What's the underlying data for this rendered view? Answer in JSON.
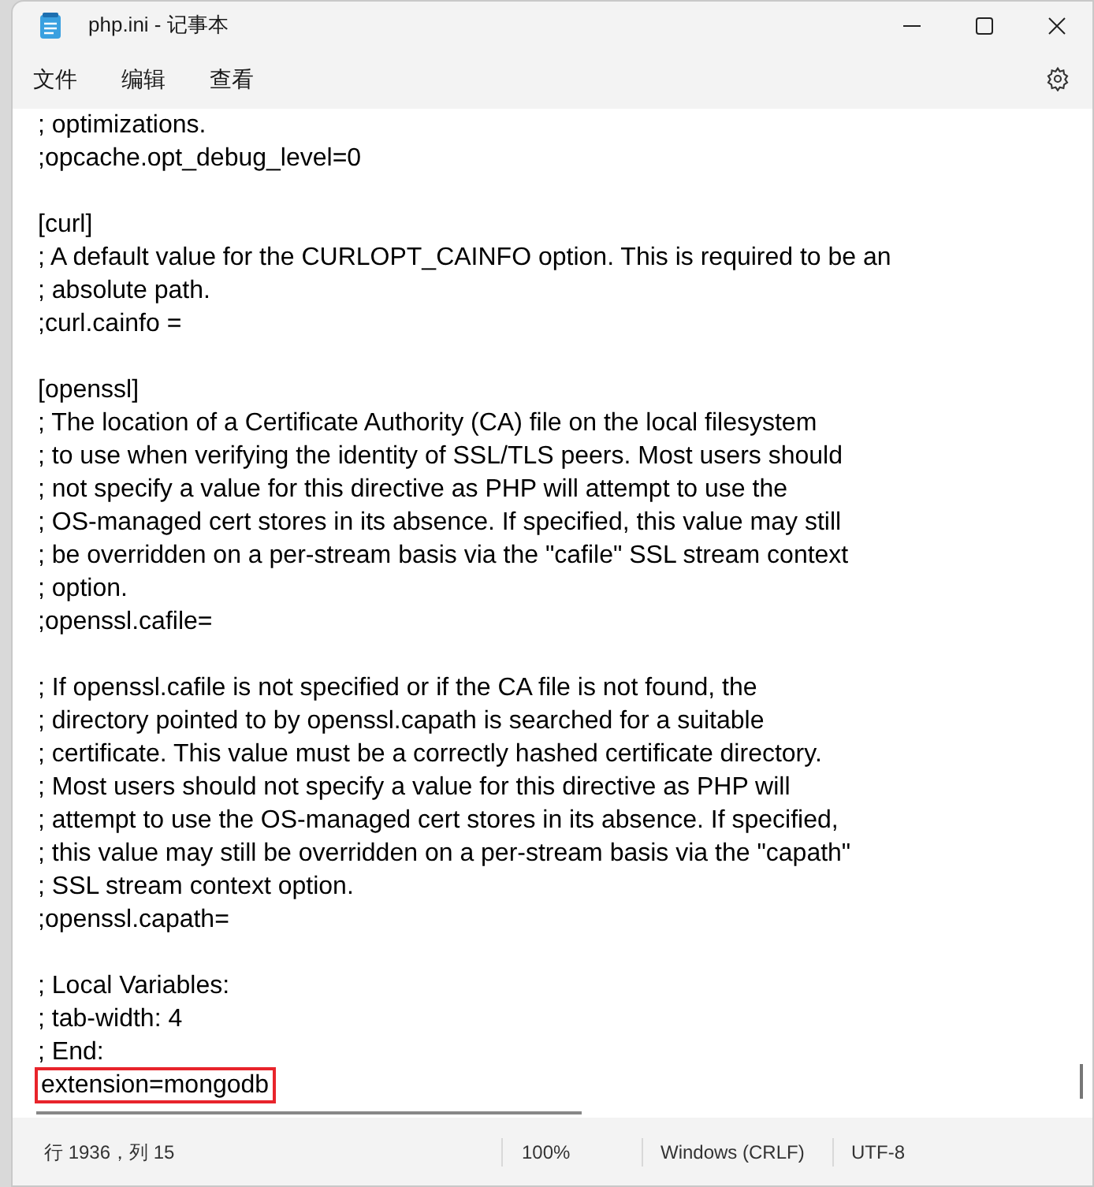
{
  "window": {
    "title": "php.ini - 记事本"
  },
  "menu": [
    {
      "label": "文件"
    },
    {
      "label": "编辑"
    },
    {
      "label": "查看"
    }
  ],
  "editor": {
    "lines": [
      {
        "kind": "text",
        "text": "; optimizations.",
        "highlighted": false
      },
      {
        "kind": "text",
        "text": ";opcache.opt_debug_level=0",
        "highlighted": false
      },
      {
        "kind": "blank"
      },
      {
        "kind": "text",
        "text": "[curl]",
        "highlighted": false
      },
      {
        "kind": "text",
        "text": "; A default value for the CURLOPT_CAINFO option. This is required to be an",
        "highlighted": false
      },
      {
        "kind": "text",
        "text": "; absolute path.",
        "highlighted": false
      },
      {
        "kind": "text",
        "text": ";curl.cainfo =",
        "highlighted": false
      },
      {
        "kind": "blank"
      },
      {
        "kind": "text",
        "text": "[openssl]",
        "highlighted": false
      },
      {
        "kind": "text",
        "text": "; The location of a Certificate Authority (CA) file on the local filesystem",
        "highlighted": false
      },
      {
        "kind": "text",
        "text": "; to use when verifying the identity of SSL/TLS peers. Most users should",
        "highlighted": false
      },
      {
        "kind": "text",
        "text": "; not specify a value for this directive as PHP will attempt to use the",
        "highlighted": false
      },
      {
        "kind": "text",
        "text": "; OS-managed cert stores in its absence. If specified, this value may still",
        "highlighted": false
      },
      {
        "kind": "text",
        "text": "; be overridden on a per-stream basis via the \"cafile\" SSL stream context",
        "highlighted": false
      },
      {
        "kind": "text",
        "text": "; option.",
        "highlighted": false
      },
      {
        "kind": "text",
        "text": ";openssl.cafile=",
        "highlighted": false
      },
      {
        "kind": "blank"
      },
      {
        "kind": "text",
        "text": "; If openssl.cafile is not specified or if the CA file is not found, the",
        "highlighted": false
      },
      {
        "kind": "text",
        "text": "; directory pointed to by openssl.capath is searched for a suitable",
        "highlighted": false
      },
      {
        "kind": "text",
        "text": "; certificate. This value must be a correctly hashed certificate directory.",
        "highlighted": false
      },
      {
        "kind": "text",
        "text": "; Most users should not specify a value for this directive as PHP will",
        "highlighted": false
      },
      {
        "kind": "text",
        "text": "; attempt to use the OS-managed cert stores in its absence. If specified,",
        "highlighted": false
      },
      {
        "kind": "text",
        "text": "; this value may still be overridden on a per-stream basis via the \"capath\"",
        "highlighted": false
      },
      {
        "kind": "text",
        "text": "; SSL stream context option.",
        "highlighted": false
      },
      {
        "kind": "text",
        "text": ";openssl.capath=",
        "highlighted": false
      },
      {
        "kind": "blank"
      },
      {
        "kind": "text",
        "text": "; Local Variables:",
        "highlighted": false
      },
      {
        "kind": "text",
        "text": "; tab-width: 4",
        "highlighted": false
      },
      {
        "kind": "text",
        "text": "; End:",
        "highlighted": false
      },
      {
        "kind": "text",
        "text": "extension=mongodb",
        "highlighted": true
      }
    ]
  },
  "status_bar": {
    "position": "行 1936，列 15",
    "zoom": "100%",
    "line_ending": "Windows (CRLF)",
    "encoding": "UTF-8"
  }
}
